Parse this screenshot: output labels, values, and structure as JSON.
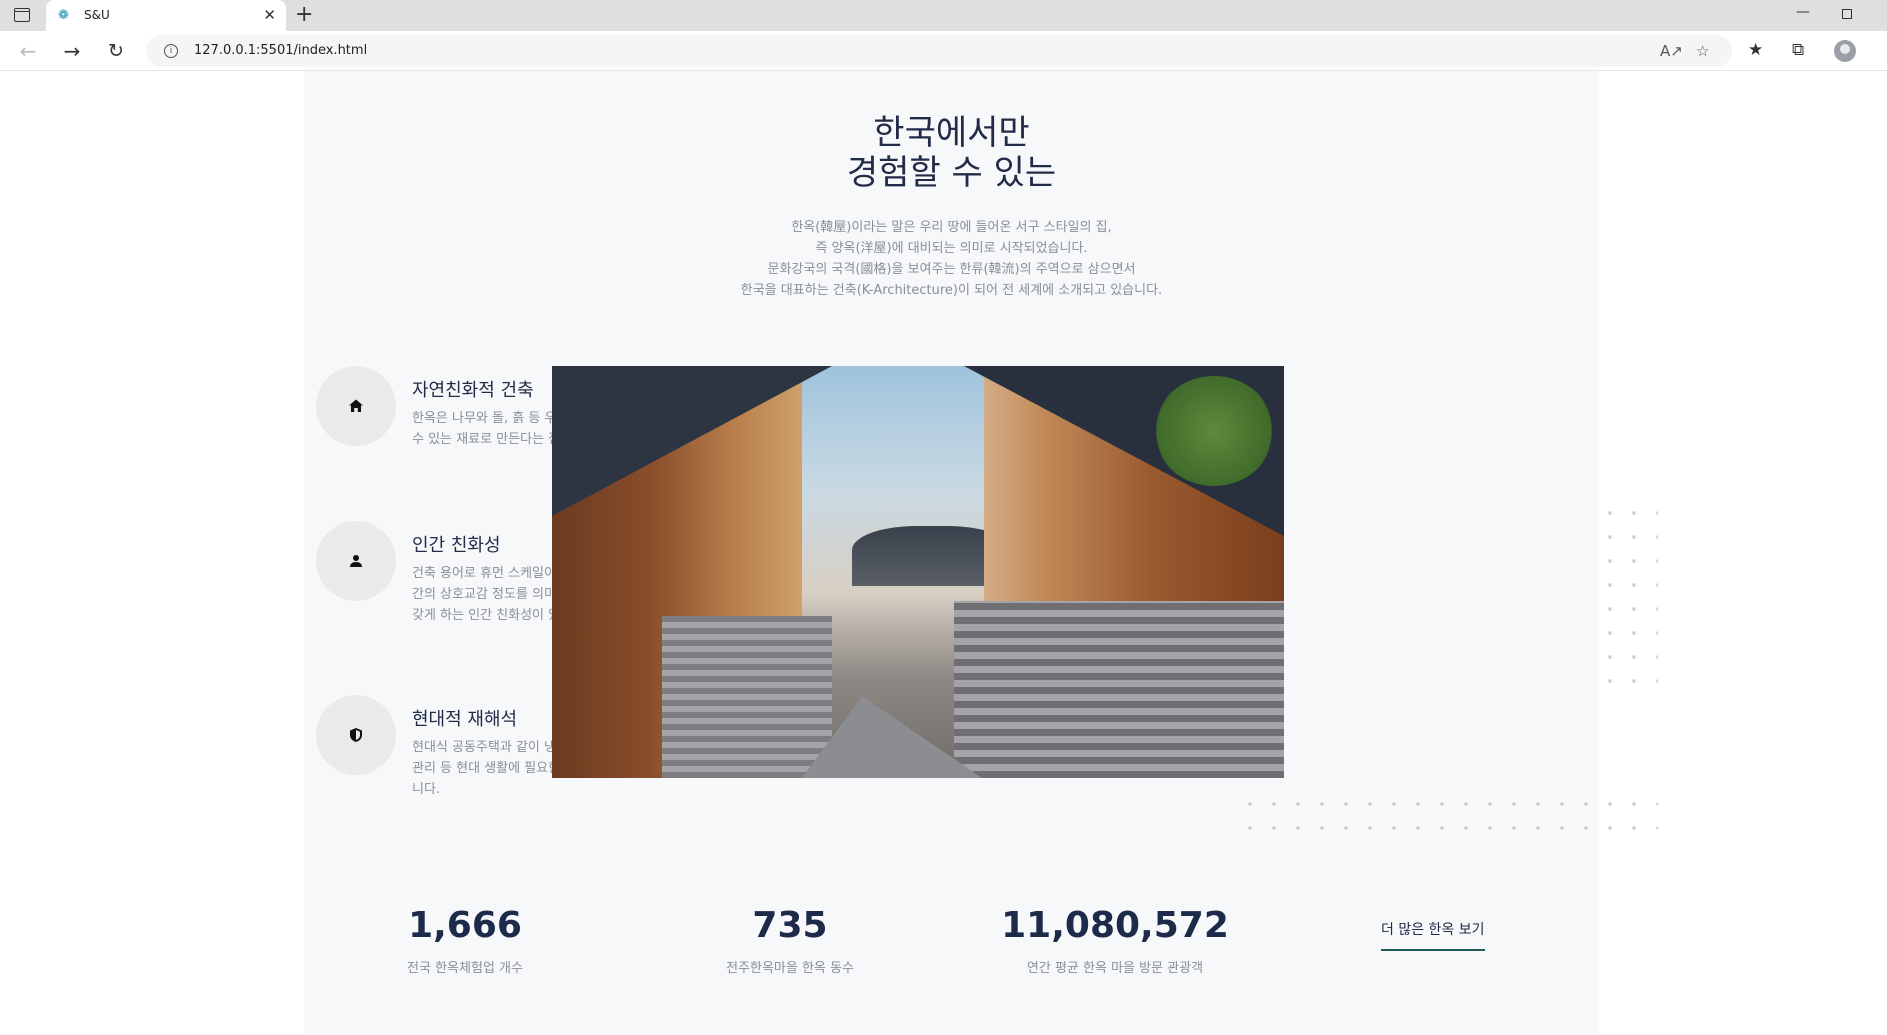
{
  "browser": {
    "tab_title": "S&U",
    "url": "127.0.0.1:5501/index.html",
    "icons": [
      "sidebar-toggle-icon",
      "favicon-icon",
      "close-icon",
      "new-tab-icon",
      "back-icon",
      "forward-icon",
      "reload-icon",
      "info-icon",
      "read-aloud-icon",
      "favorite-add-icon",
      "favorites-icon",
      "collections-icon",
      "profile-icon",
      "minimize-icon",
      "maximize-icon"
    ]
  },
  "hero": {
    "title_line1": "한국에서만",
    "title_line2": "경험할 수 있는",
    "intro": [
      "한옥(韓屋)이라는 말은 우리 땅에 들어온 서구 스타일의 집,",
      "즉 양옥(洋屋)에 대비되는 의미로 시작되었습니다.",
      "문화강국의 국격(國格)을 보여주는 한류(韓流)의 주역으로 삼으면서",
      "한국을 대표하는 건축(K-Architecture)이 되어 전 세계에 소개되고 있습니다."
    ]
  },
  "features": [
    {
      "icon": "home-icon",
      "title": "자연친화적 건축",
      "text": "한옥은 나무와 돌, 흙 등 우리 주위 어디에서나 손쉽게 구할 수 있는 재료로 만든다는 점에서 자연친화적입니다."
    },
    {
      "icon": "person-icon",
      "title": "인간 친화성",
      "text": "건축 용어로 휴먼 스케일이라 하는 인간 친화성은 공간과 인간의 상호교감 정도를 의미하는데 한옥에는 심리적 안정을 갖게 하는 인간 친화성이 있습니다."
    },
    {
      "icon": "shield-icon",
      "title": "현대적 재해석",
      "text": "현대식 공동주택과 같이 냉·난방 등 에너지관리, 보안, 유지관리 등 현대 생활에 필요한 주택 주요 기능을 갖추고 있습니다."
    }
  ],
  "stats": [
    {
      "value": "1,666",
      "label": "전국 한옥체험업 개수"
    },
    {
      "value": "735",
      "label": "전주한옥마을 한옥 동수"
    },
    {
      "value": "11,080,572",
      "label": "연간 평균 한옥 마을 방문 관광객"
    }
  ],
  "more_link": "더 많은 한옥 보기",
  "colors": {
    "heading": "#222c48",
    "body_text": "#8a8f98",
    "panel_bg": "#f6f8fa",
    "link_underline": "#1e5b55",
    "stat_number": "#1d2a4a"
  }
}
